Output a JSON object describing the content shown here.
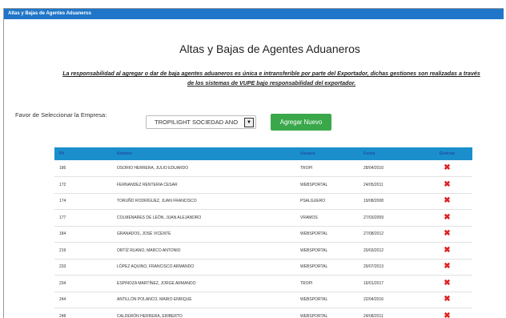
{
  "window": {
    "title": "Altas y Bajas de Agentes Aduaneros"
  },
  "page": {
    "title": "Altas y Bajas de Agentes Aduaneros",
    "notice_line1": "La responsabilidad al agregar o dar de baja agentes aduaneros es única e intransferible por parte del Exportador, dichas gestiones son realizadas a través",
    "notice_line2": "de los sistemas de VUPE bajo responsabilidad del exportador."
  },
  "company": {
    "label": "Favor de Seleccionar la Empresa:",
    "selected": "TROPILIGHT SOCIEDAD ANO"
  },
  "add_button": {
    "label": "Agregar Nuevo"
  },
  "table": {
    "headers": {
      "pk": "Pk",
      "name": "Nombre",
      "user": "Usuario",
      "date": "Fecha",
      "delete": "Eliminar"
    },
    "rows": [
      {
        "pk": "186",
        "name": "OSORIO HERRERA, JULIO EDUARDO",
        "user": "TROPI",
        "date": "28/04/2010"
      },
      {
        "pk": "172",
        "name": "FERNANDEZ RENTERIA CESAR",
        "user": "WEBSPORTAL",
        "date": "24/05/2011"
      },
      {
        "pk": "174",
        "name": "TORUÑO RODRÍGUEZ, JUAN FRANCISCO",
        "user": "PSALGUERO",
        "date": "19/08/2008"
      },
      {
        "pk": "177",
        "name": "COLMENARES DE LEÓN, JUAN ALEJANDRO",
        "user": "VRAMOS",
        "date": "27/03/2009"
      },
      {
        "pk": "184",
        "name": "GRANADOS, JOSÉ VICENTE",
        "user": "WEBSPORTAL",
        "date": "27/08/2012"
      },
      {
        "pk": "219",
        "name": "ORTÍZ RUANO, MARCO ANTONIO",
        "user": "WEBSPORTAL",
        "date": "20/03/2012"
      },
      {
        "pk": "233",
        "name": "LÓPEZ AQUINO, FRANCISCO ARMANDO",
        "user": "WEBSPORTAL",
        "date": "29/07/2013"
      },
      {
        "pk": "234",
        "name": "ESPINOZA MARTÍNEZ, JORGE ARMANDO",
        "user": "TROPI",
        "date": "16/01/2017"
      },
      {
        "pk": "244",
        "name": "ANTILLÓN POLANCO, MARIO ENRIQUE",
        "user": "WEBSPORTAL",
        "date": "22/04/2016"
      },
      {
        "pk": "248",
        "name": "CALDERÓN HERRERA, ERIBERTO",
        "user": "WEBSPORTAL",
        "date": "24/08/2011"
      }
    ]
  },
  "colors": {
    "titlebar": "#1f76c8",
    "table_header": "#1a8fcc",
    "button": "#3aa84a",
    "delete": "#e02020"
  },
  "icons": {
    "delete": "red-x-icon",
    "dropdown": "chevron-down-icon"
  }
}
